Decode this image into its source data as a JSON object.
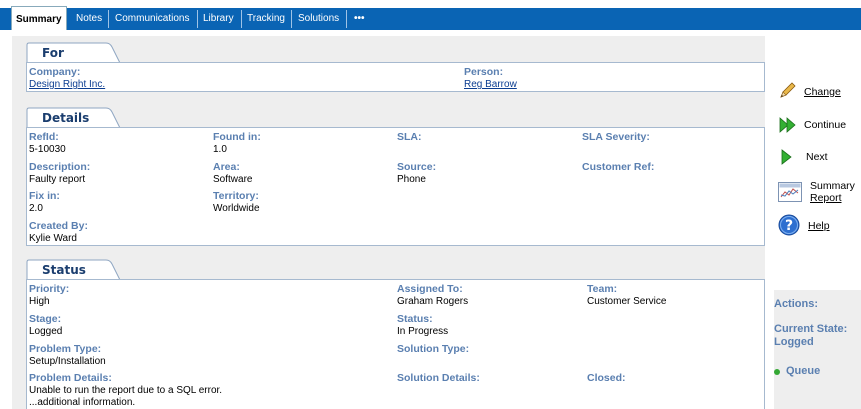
{
  "tabs": [
    {
      "label": "Summary",
      "active": true
    },
    {
      "label": "Notes"
    },
    {
      "label": "Communications"
    },
    {
      "label": "Library"
    },
    {
      "label": "Tracking"
    },
    {
      "label": "Solutions"
    },
    {
      "label": "•••"
    }
  ],
  "for_section": {
    "title": "For",
    "company_label": "Company:",
    "company_value": "Design Right Inc.",
    "person_label": "Person:",
    "person_value": "Reg Barrow"
  },
  "details_section": {
    "title": "Details",
    "refid_label": "RefId:",
    "refid_value": "5-10030",
    "found_in_label": "Found in:",
    "found_in_value": "1.0",
    "sla_label": "SLA:",
    "sla_severity_label": "SLA Severity:",
    "description_label": "Description:",
    "description_value": "Faulty report",
    "area_label": "Area:",
    "area_value": "Software",
    "source_label": "Source:",
    "source_value": "Phone",
    "customer_ref_label": "Customer Ref:",
    "fix_in_label": "Fix in:",
    "fix_in_value": "2.0",
    "territory_label": "Territory:",
    "territory_value": "Worldwide",
    "created_by_label": "Created By:",
    "created_by_value": "Kylie Ward"
  },
  "status_section": {
    "title": "Status",
    "priority_label": "Priority:",
    "priority_value": "High",
    "assigned_to_label": "Assigned To:",
    "assigned_to_value": "Graham Rogers",
    "team_label": "Team:",
    "team_value": "Customer Service",
    "stage_label": "Stage:",
    "stage_value": "Logged",
    "status_label": "Status:",
    "status_value": "In Progress",
    "problem_type_label": "Problem Type:",
    "problem_type_value": "Setup/Installation",
    "solution_type_label": "Solution Type:",
    "problem_details_label": "Problem Details:",
    "problem_details_line1": "Unable to run the report due to a SQL error.",
    "problem_details_line2": "...additional information.",
    "solution_details_label": "Solution Details:",
    "closed_label": "Closed:"
  },
  "sidebar": {
    "change_label": "Change",
    "continue_label": "Continue",
    "next_label": "Next",
    "summary_label_1": "Summary",
    "summary_label_2": "Report",
    "help_label": "Help",
    "actions_label": "Actions:",
    "current_state_label": "Current State:",
    "current_state_value": "Logged",
    "queue_label": "Queue"
  }
}
